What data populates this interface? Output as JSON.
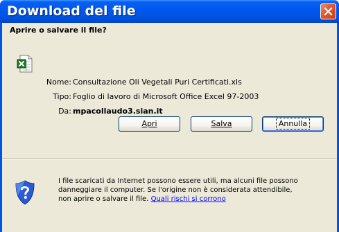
{
  "window": {
    "title": "Download del file",
    "close_icon": "close-icon"
  },
  "dialog": {
    "heading": "Aprire o salvare il file?",
    "file_icon": "excel-file-icon",
    "fields": {
      "name_label": "Nome:",
      "name_value": "Consultazione Oli Vegetali Puri Certificati.xls",
      "type_label": "Tipo:",
      "type_value": "Foglio di lavoro di Microsoft Office Excel 97-2003",
      "from_label": "Da:",
      "from_value": "mpacollaudo3.sian.it"
    },
    "buttons": {
      "open_label": "Apri",
      "save_label": "Salva",
      "cancel_label": "Annulla"
    },
    "warning": {
      "icon": "shield-icon",
      "line1": "I file scaricati da Internet possono essere utili, ma alcuni file possono",
      "line2": "danneggiare il computer. Se l'origine non è considerata attendibile,",
      "line3": "non aprire o salvare il file.",
      "link": "Quali rischi si corrono"
    }
  },
  "colors": {
    "titlebar": "#0058ee",
    "dialog_bg": "#ece9d8",
    "close_button": "#e3552d",
    "link": "#0000ff"
  }
}
